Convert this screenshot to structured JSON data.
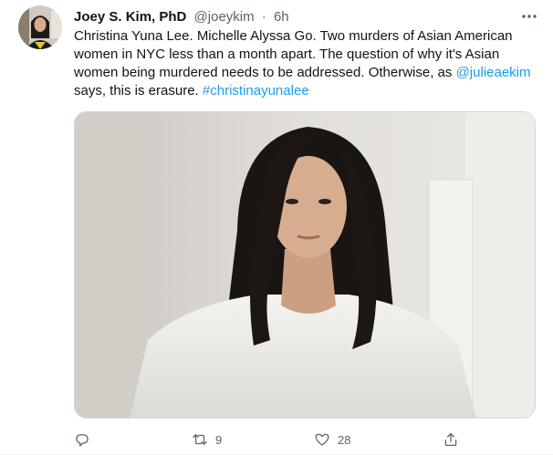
{
  "tweet": {
    "author": {
      "display_name": "Joey S. Kim, PhD",
      "handle": "@joeykim",
      "separator": "·",
      "time": "6h"
    },
    "text": {
      "part1": "Christina Yuna Lee. Michelle Alyssa Go. Two murders of Asian American women in NYC less than a month apart. The question of why it's Asian women being murdered needs to be addressed. Otherwise, as ",
      "mention": "@julieaekim",
      "part2": " says, this is erasure. ",
      "hashtag": "#christinayunalee"
    },
    "stats": {
      "replies": "",
      "retweets": "9",
      "likes": "28"
    },
    "icons": {
      "more": "more-horizontal-icon",
      "reply": "reply-icon",
      "retweet": "retweet-icon",
      "like": "heart-icon",
      "share": "share-icon"
    },
    "colors": {
      "link": "#1d9bf0",
      "secondary_text": "#536471",
      "primary_text": "#0f1419"
    }
  }
}
